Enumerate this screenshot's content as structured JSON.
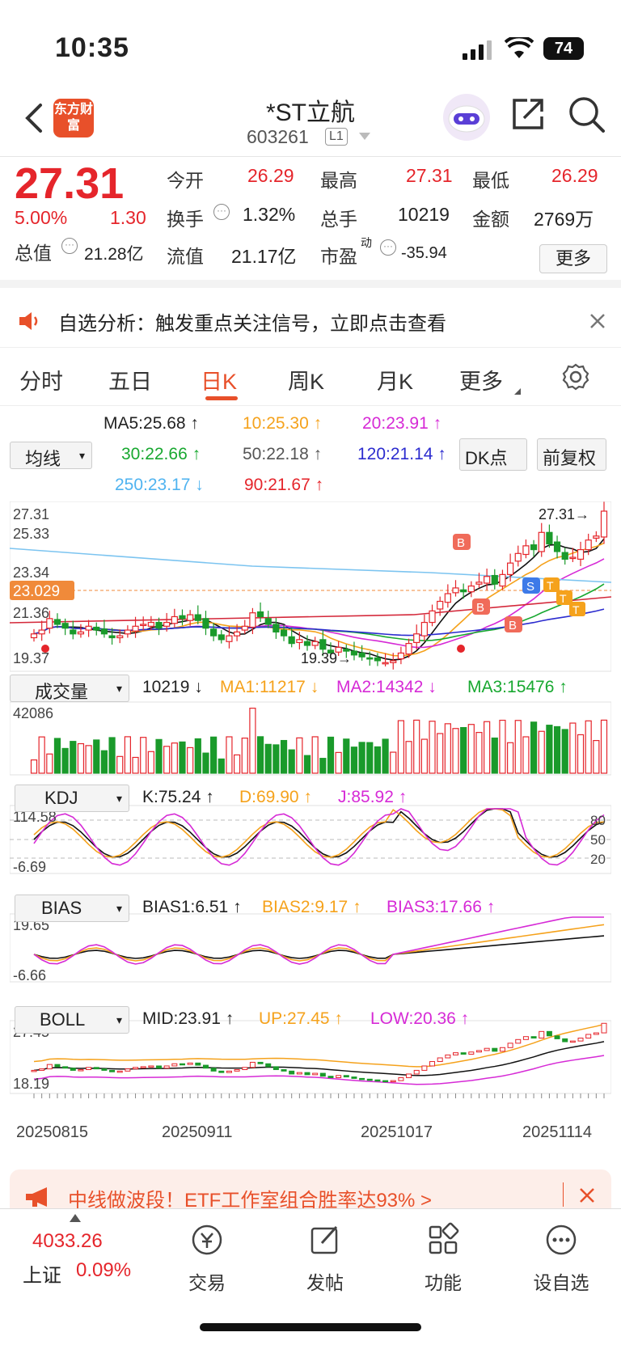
{
  "status_bar": {
    "time": "10:35",
    "battery": "74"
  },
  "header": {
    "brand": "东方财富",
    "stock_name": "*ST立航",
    "stock_code": "603261",
    "level": "L1"
  },
  "quote": {
    "price": "27.31",
    "change_pct": "5.00%",
    "change": "1.30",
    "open_label": "今开",
    "open": "26.29",
    "high_label": "最高",
    "high": "27.31",
    "low_label": "最低",
    "low": "26.29",
    "turnover_label": "换手",
    "turnover": "1.32%",
    "volume_label": "总手",
    "volume": "10219",
    "amount_label": "金额",
    "amount": "2769万",
    "mktcap_label": "总值",
    "mktcap": "21.28亿",
    "float_label": "流值",
    "float_cap": "21.17亿",
    "pe_label": "市盈",
    "pe_sup": "动",
    "pe": "-35.94",
    "more_label": "更多"
  },
  "notice": {
    "text": "自选分析：触发重点关注信号，立即点击查看"
  },
  "tabs": [
    "分时",
    "五日",
    "日K",
    "周K",
    "月K",
    "更多"
  ],
  "active_tab": "日K",
  "ma": {
    "selector": "均线",
    "ma5": "MA5:25.68",
    "ma10": "10:25.30",
    "ma20": "20:23.91",
    "ma30": "30:22.66",
    "ma50": "50:22.18",
    "ma120": "120:21.14",
    "ma250": "250:23.17",
    "ma90": "90:21.67",
    "dk_button": "DK点",
    "adjust_button": "前复权"
  },
  "candle_panel": {
    "top_label": "27.31",
    "second_label": "25.33",
    "mid_label": "23.34",
    "current_marker": "23.029",
    "low_label": "21.36",
    "bottom_label": "19.37",
    "high_callout": "27.31→",
    "low_callout": "19.39→"
  },
  "volume_panel": {
    "selector": "成交量",
    "vol": "10219",
    "ma1": "MA1:11217",
    "ma2": "MA2:14342",
    "ma3": "MA3:15476",
    "max_label": "42086"
  },
  "kdj_panel": {
    "selector": "KDJ",
    "k": "K:75.24",
    "d": "D:69.90",
    "j": "J:85.92",
    "max_label": "114.58",
    "min_label": "-6.69",
    "lv80": "80",
    "lv50": "50",
    "lv20": "20"
  },
  "bias_panel": {
    "selector": "BIAS",
    "b1": "BIAS1:6.51",
    "b2": "BIAS2:9.17",
    "b3": "BIAS3:17.66",
    "max_label": "19.65",
    "min_label": "-6.66"
  },
  "boll_panel": {
    "selector": "BOLL",
    "mid": "MID:23.91",
    "up": "UP:27.45",
    "low": "LOW:20.36",
    "max_label": "27.45",
    "min_label": "18.19"
  },
  "dates": [
    "20250815",
    "20250911",
    "20251017",
    "20251114"
  ],
  "banner": {
    "text": "中线做波段！ETF工作室组合胜率达93% >"
  },
  "bottom_nav": {
    "index_value": "4033.26",
    "index_name": "上证",
    "index_change": "0.09%",
    "items": [
      "交易",
      "发帖",
      "功能",
      "设自选"
    ]
  },
  "colors": {
    "up": "#e5252b",
    "down": "#1a9a2b",
    "brand": "#e8502a",
    "ma10": "#f5a21c",
    "ma20": "#d62ad6"
  },
  "chart_data": {
    "type": "candlestick",
    "title": "*ST立航 日K",
    "ylim": [
      19.37,
      27.31
    ],
    "closes": [
      20.9,
      21.1,
      21.7,
      21.4,
      21.2,
      20.9,
      21.0,
      21.3,
      21.1,
      20.9,
      20.7,
      20.8,
      21.1,
      21.3,
      21.4,
      21.5,
      21.2,
      21.5,
      21.8,
      21.7,
      21.9,
      21.6,
      21.2,
      20.8,
      20.6,
      20.8,
      21.0,
      21.3,
      22.0,
      21.8,
      21.4,
      21.0,
      20.8,
      20.4,
      20.6,
      20.3,
      20.5,
      20.1,
      19.9,
      20.2,
      20.0,
      19.8,
      19.7,
      19.6,
      19.5,
      19.4,
      19.5,
      19.9,
      20.4,
      20.9,
      21.5,
      22.1,
      22.6,
      23.0,
      23.3,
      23.1,
      23.4,
      23.6,
      23.9,
      23.5,
      24.0,
      24.6,
      25.1,
      25.5,
      25.3,
      26.2,
      25.6,
      25.2,
      24.8,
      24.9,
      25.3,
      25.8,
      26.01,
      27.31
    ],
    "volume": {
      "max": 42086,
      "last": 10219
    },
    "kdj": {
      "k": 75.24,
      "d": 69.9,
      "j": 85.92
    },
    "bias": {
      "bias1": 6.51,
      "bias2": 9.17,
      "bias3": 17.66
    },
    "boll": {
      "mid": 23.91,
      "up": 27.45,
      "low": 20.36
    }
  }
}
